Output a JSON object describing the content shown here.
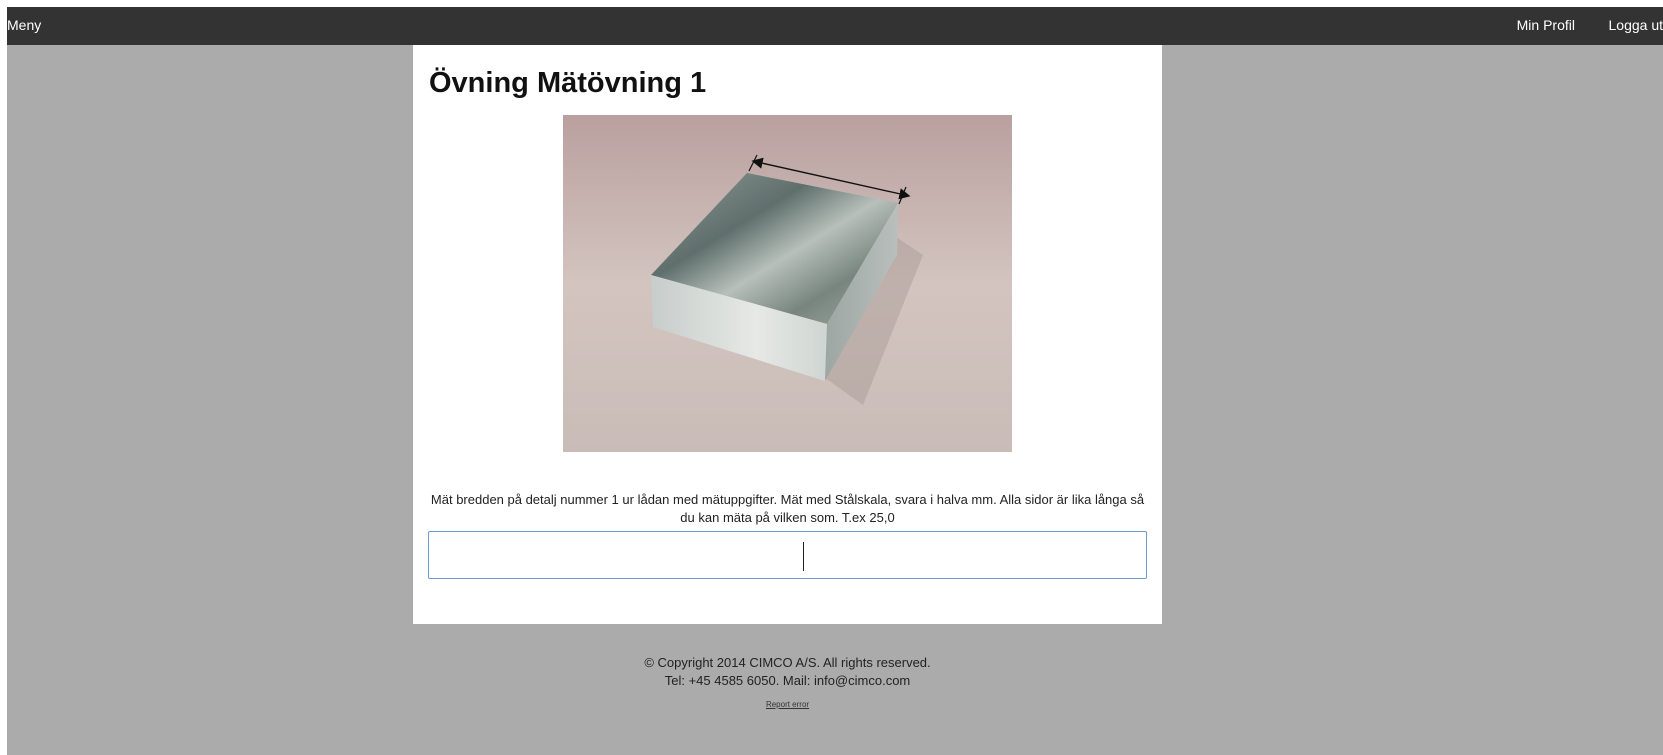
{
  "navbar": {
    "menu_label": "Meny",
    "profile_label": "Min Profil",
    "logout_label": "Logga ut"
  },
  "exercise": {
    "title": "Övning Mätövning 1",
    "instructions": "Mät bredden på detalj nummer 1 ur lådan med mätuppgifter. Mät med Stålskala, svara i halva mm. Alla sidor är lika långa så du kan mäta på vilken som. T.ex 25,0",
    "answer_value": ""
  },
  "footer": {
    "copyright": "© Copyright 2014 CIMCO A/S. All rights reserved.",
    "contact": "Tel: +45 4585 6050. Mail: info@cimco.com",
    "report_label": "Report error"
  },
  "colors": {
    "navbar_bg": "#333333",
    "page_bg": "#ababab",
    "input_border": "#6d9bd3"
  }
}
